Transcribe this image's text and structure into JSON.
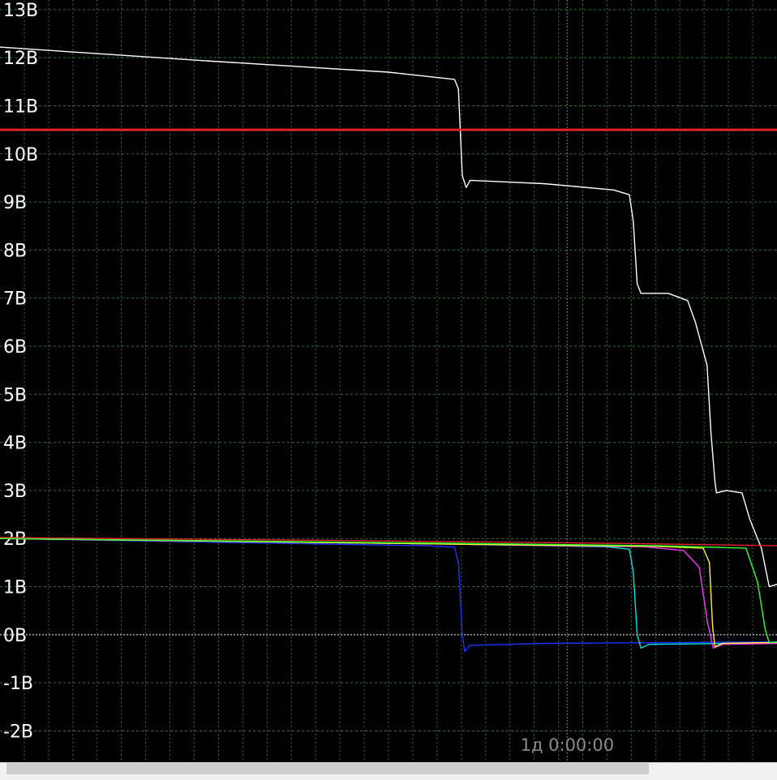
{
  "chart_data": {
    "type": "line",
    "y_ticks": [
      "13В",
      "12В",
      "11В",
      "10В",
      "9В",
      "8В",
      "7В",
      "6В",
      "5В",
      "4В",
      "3В",
      "2В",
      "1В",
      "0В",
      "-1В",
      "-2В"
    ],
    "y_tick_values": [
      13,
      12,
      11,
      10,
      9,
      8,
      7,
      6,
      5,
      4,
      3,
      2,
      1,
      0,
      -1,
      -2
    ],
    "x_ticks": [
      "1д 0:00:00"
    ],
    "x_tick_values": [
      0.73
    ],
    "ylim": [
      -2.65,
      13.2
    ],
    "xlim": [
      0,
      1
    ],
    "grid": true,
    "threshold": {
      "value": 10.5,
      "color": "#e8222c"
    },
    "zero_line_color": "#ffffff",
    "grid_color": "#3d6b3d",
    "series": [
      {
        "color": "#ffffff",
        "points": [
          [
            0,
            12.22
          ],
          [
            0.25,
            11.95
          ],
          [
            0.5,
            11.7
          ],
          [
            0.585,
            11.55
          ],
          [
            0.59,
            11.35
          ],
          [
            0.595,
            9.55
          ],
          [
            0.6,
            9.3
          ],
          [
            0.605,
            9.45
          ],
          [
            0.7,
            9.38
          ],
          [
            0.79,
            9.25
          ],
          [
            0.81,
            9.15
          ],
          [
            0.815,
            8.6
          ],
          [
            0.82,
            7.3
          ],
          [
            0.825,
            7.1
          ],
          [
            0.86,
            7.1
          ],
          [
            0.885,
            6.95
          ],
          [
            0.895,
            6.5
          ],
          [
            0.91,
            5.6
          ],
          [
            0.915,
            4.2
          ],
          [
            0.92,
            3.2
          ],
          [
            0.922,
            2.95
          ],
          [
            0.935,
            3.0
          ],
          [
            0.955,
            2.95
          ],
          [
            0.965,
            2.4
          ],
          [
            0.98,
            1.8
          ],
          [
            0.99,
            1.0
          ],
          [
            1.0,
            1.05
          ]
        ]
      },
      {
        "color": "#e8222c",
        "points": [
          [
            0,
            2.02
          ],
          [
            0.5,
            1.95
          ],
          [
            0.8,
            1.9
          ],
          [
            1.0,
            1.85
          ]
        ]
      },
      {
        "color": "#1a33ff",
        "points": [
          [
            0,
            2.0
          ],
          [
            0.55,
            1.85
          ],
          [
            0.585,
            1.82
          ],
          [
            0.59,
            1.5
          ],
          [
            0.595,
            0.0
          ],
          [
            0.598,
            -0.35
          ],
          [
            0.605,
            -0.22
          ],
          [
            0.7,
            -0.18
          ],
          [
            1.0,
            -0.15
          ]
        ]
      },
      {
        "color": "#00e5e5",
        "points": [
          [
            0,
            2.0
          ],
          [
            0.6,
            1.88
          ],
          [
            0.78,
            1.83
          ],
          [
            0.81,
            1.78
          ],
          [
            0.815,
            1.3
          ],
          [
            0.82,
            0.0
          ],
          [
            0.825,
            -0.28
          ],
          [
            0.835,
            -0.2
          ],
          [
            1.0,
            -0.17
          ]
        ]
      },
      {
        "color": "#ff33ff",
        "points": [
          [
            0,
            2.0
          ],
          [
            0.6,
            1.88
          ],
          [
            0.83,
            1.83
          ],
          [
            0.88,
            1.75
          ],
          [
            0.9,
            1.4
          ],
          [
            0.91,
            0.3
          ],
          [
            0.918,
            -0.28
          ],
          [
            0.93,
            -0.2
          ],
          [
            1.0,
            -0.18
          ]
        ]
      },
      {
        "color": "#ffee33",
        "points": [
          [
            0,
            2.0
          ],
          [
            0.6,
            1.88
          ],
          [
            0.84,
            1.84
          ],
          [
            0.905,
            1.8
          ],
          [
            0.913,
            1.5
          ],
          [
            0.917,
            0.2
          ],
          [
            0.92,
            -0.25
          ],
          [
            0.93,
            -0.18
          ],
          [
            1.0,
            -0.16
          ]
        ]
      },
      {
        "color": "#33ff33",
        "points": [
          [
            0,
            2.0
          ],
          [
            0.6,
            1.9
          ],
          [
            0.85,
            1.85
          ],
          [
            0.96,
            1.8
          ],
          [
            0.975,
            1.1
          ],
          [
            0.985,
            0.1
          ],
          [
            0.99,
            -0.17
          ],
          [
            1.0,
            -0.15
          ]
        ]
      }
    ]
  }
}
